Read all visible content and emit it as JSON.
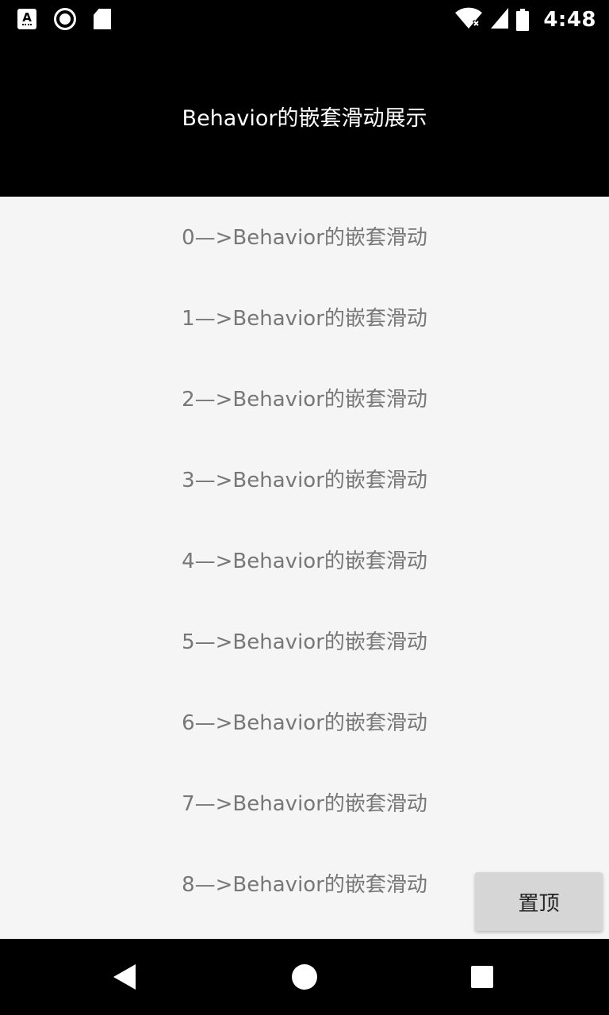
{
  "status_bar": {
    "time": "4:48",
    "icons": [
      "accessibility-a-icon",
      "record-icon",
      "sd-card-icon",
      "wifi-icon",
      "signal-icon",
      "battery-icon"
    ]
  },
  "app_bar": {
    "title": "Behavior的嵌套滑动展示"
  },
  "list": {
    "items": [
      "0—>Behavior的嵌套滑动",
      "1—>Behavior的嵌套滑动",
      "2—>Behavior的嵌套滑动",
      "3—>Behavior的嵌套滑动",
      "4—>Behavior的嵌套滑动",
      "5—>Behavior的嵌套滑动",
      "6—>Behavior的嵌套滑动",
      "7—>Behavior的嵌套滑动",
      "8—>Behavior的嵌套滑动"
    ]
  },
  "fab": {
    "label": "置顶"
  },
  "nav_bar": {
    "icons": [
      "back-icon",
      "home-icon",
      "recents-icon"
    ]
  },
  "colors": {
    "status_bar_bg": "#000000",
    "app_bar_bg": "#000000",
    "list_bg": "#f5f5f5",
    "list_text": "#777777",
    "button_bg": "#d6d6d6"
  }
}
